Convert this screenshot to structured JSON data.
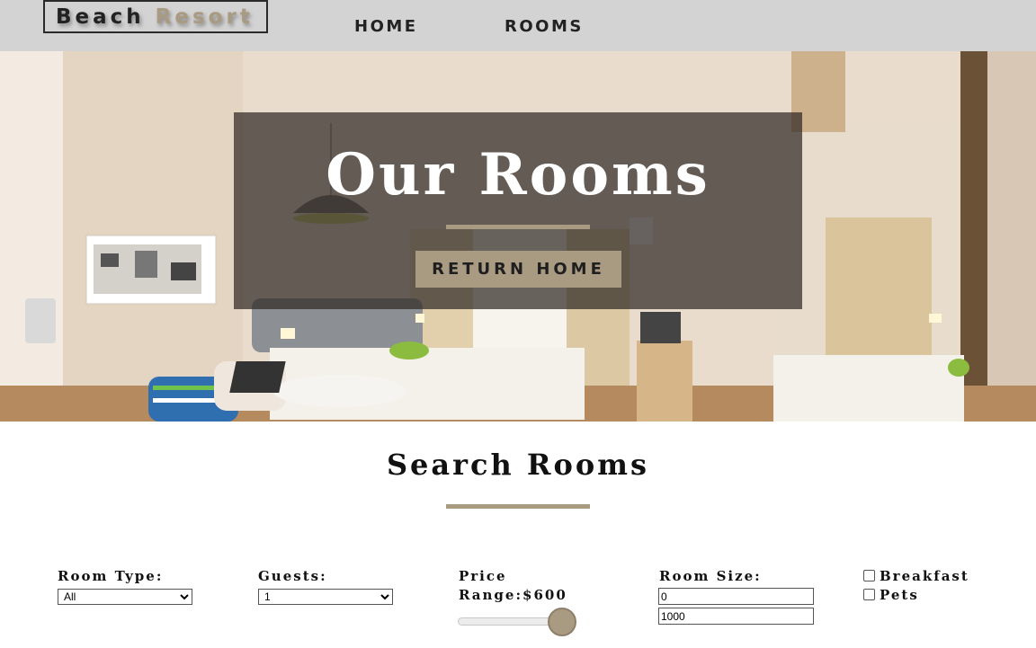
{
  "navbar": {
    "logo_word1": "Beach",
    "logo_word2": "Resort",
    "links": [
      "HOME",
      "ROOMS"
    ]
  },
  "hero": {
    "title": "Our Rooms",
    "button_label": "RETURN HOME"
  },
  "search": {
    "title": "Search Rooms",
    "room_type": {
      "label": "Room Type:",
      "value": "All"
    },
    "guests": {
      "label": "Guests:",
      "value": "1"
    },
    "price": {
      "label": "Price Range:$600",
      "value": 600,
      "fill_fraction": 0.9
    },
    "room_size": {
      "label": "Room Size:",
      "min_value": "0",
      "max_value": "1000"
    },
    "checkboxes": [
      {
        "label": "Breakfast",
        "checked": false
      },
      {
        "label": "Pets",
        "checked": false
      }
    ]
  },
  "colors": {
    "accent": "#a99a82",
    "navbar_bg": "#d3d3d3",
    "banner_overlay": "rgba(48,42,38,0.72)"
  }
}
